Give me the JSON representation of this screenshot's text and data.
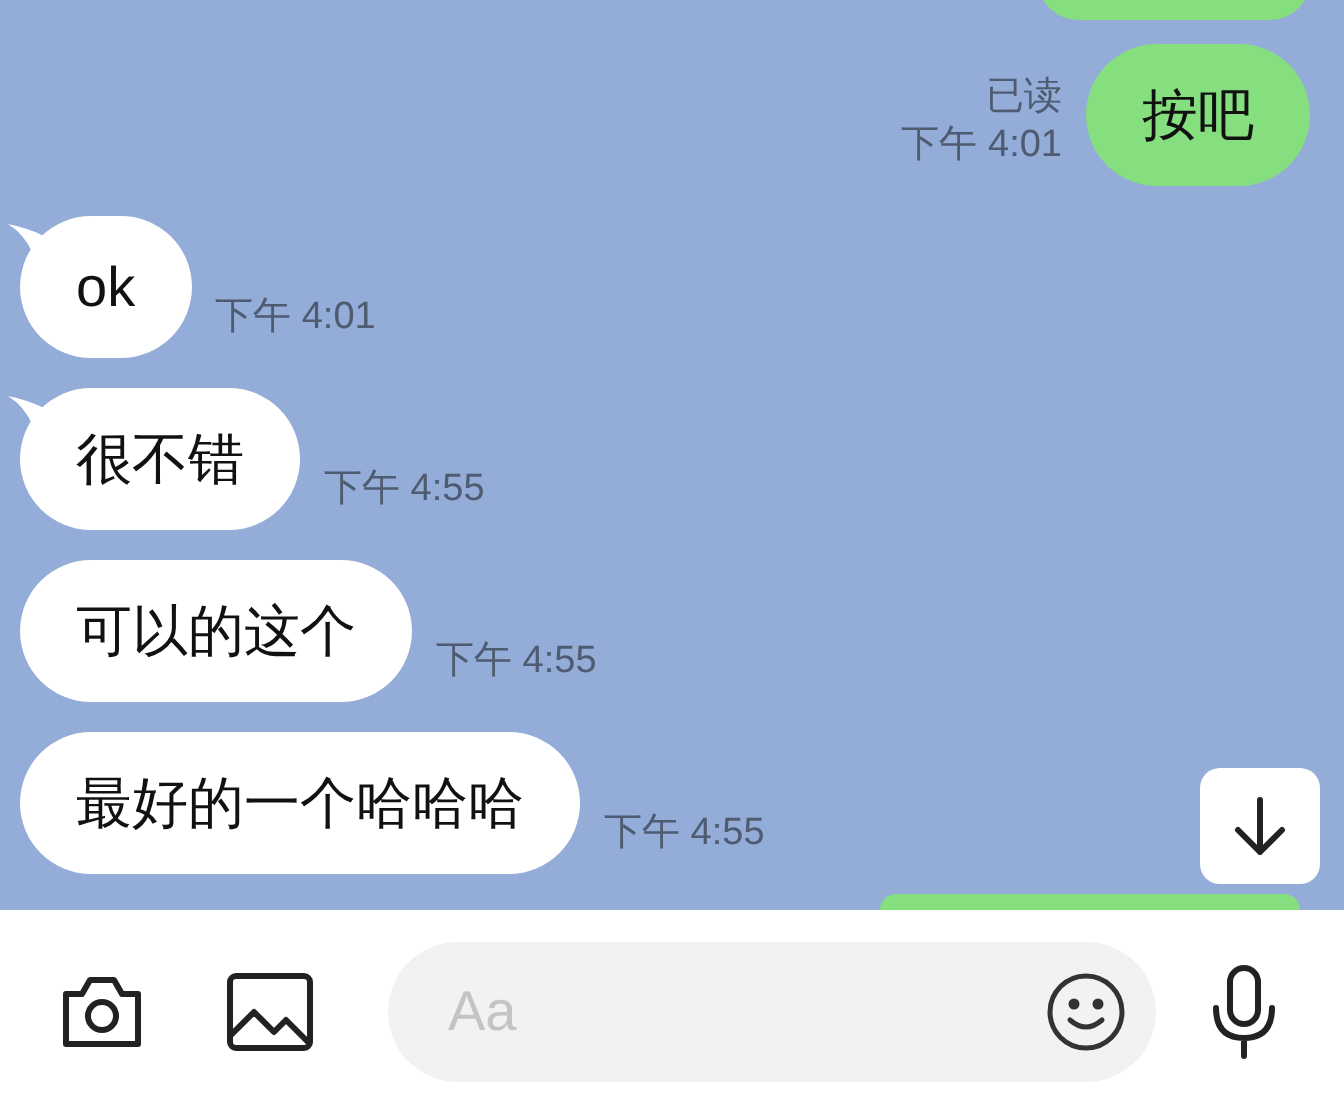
{
  "messages": [
    {
      "kind": "outgoing",
      "text": "按吧",
      "read": "已读",
      "time": "下午 4:01"
    },
    {
      "kind": "incoming",
      "text": "ok",
      "time": "下午 4:01",
      "tail": true
    },
    {
      "kind": "incoming",
      "text": "很不错",
      "time": "下午 4:55",
      "tail": true
    },
    {
      "kind": "incoming",
      "text": "可以的这个",
      "time": "下午 4:55",
      "tail": false
    },
    {
      "kind": "incoming",
      "text": "最好的一个哈哈哈",
      "time": "下午 4:55",
      "tail": false
    }
  ],
  "composer": {
    "placeholder": "Aa"
  }
}
